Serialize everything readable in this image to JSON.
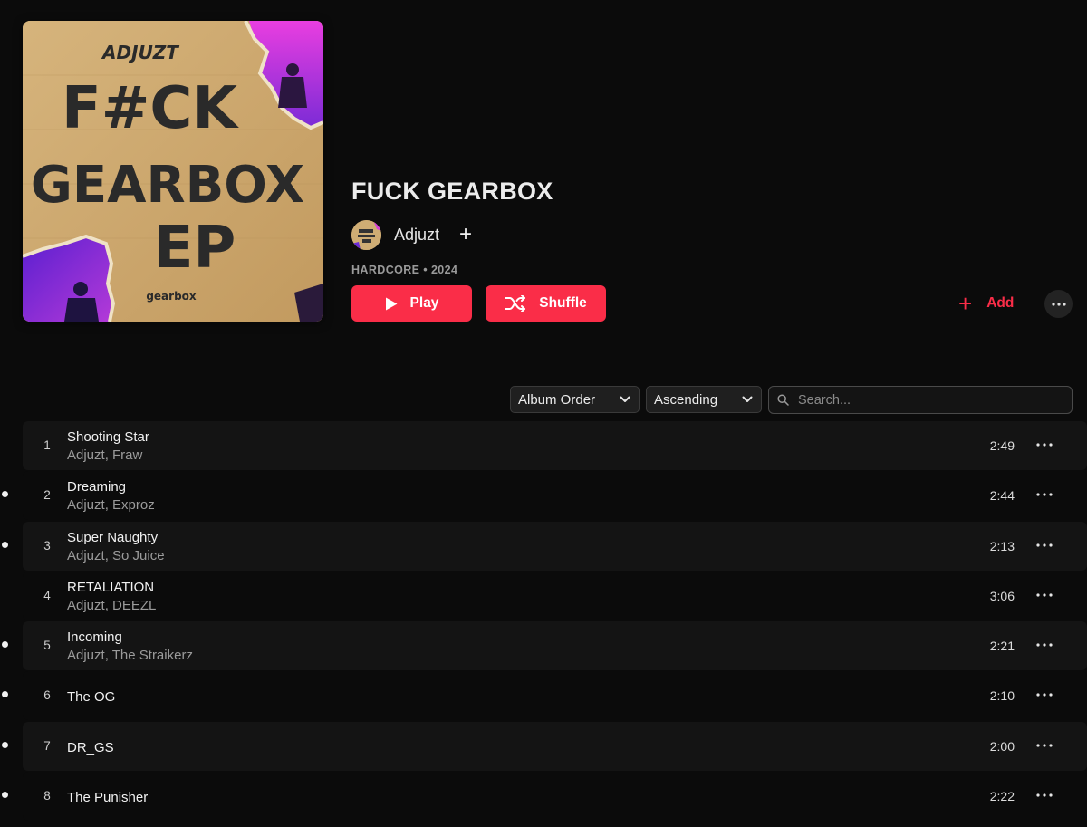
{
  "album": {
    "title": "FUCK GEARBOX",
    "artist": "Adjuzt",
    "meta": "HARDCORE • 2024",
    "cover_text": {
      "logo": "ADJUZT",
      "line1": "F#CK",
      "line2": "GEARBOX",
      "line3": "EP",
      "label": "gearbox"
    }
  },
  "actions": {
    "play_label": "Play",
    "shuffle_label": "Shuffle",
    "add_label": "Add"
  },
  "controls": {
    "sort_order": "Album Order",
    "sort_direction": "Ascending",
    "search_placeholder": "Search..."
  },
  "colors": {
    "accent": "#fa2d48",
    "background": "#0b0b0b",
    "row": "#141414"
  },
  "tracks": [
    {
      "number": "1",
      "title": "Shooting Star",
      "artists": "Adjuzt, Fraw",
      "duration": "2:49"
    },
    {
      "number": "2",
      "title": "Dreaming",
      "artists": "Adjuzt, Exproz",
      "duration": "2:44"
    },
    {
      "number": "3",
      "title": "Super Naughty",
      "artists": "Adjuzt, So Juice",
      "duration": "2:13"
    },
    {
      "number": "4",
      "title": "RETALIATION",
      "artists": "Adjuzt, DEEZL",
      "duration": "3:06"
    },
    {
      "number": "5",
      "title": "Incoming",
      "artists": "Adjuzt, The Straikerz",
      "duration": "2:21"
    },
    {
      "number": "6",
      "title": "The OG",
      "artists": "",
      "duration": "2:10"
    },
    {
      "number": "7",
      "title": "DR_GS",
      "artists": "",
      "duration": "2:00"
    },
    {
      "number": "8",
      "title": "The Punisher",
      "artists": "",
      "duration": "2:22"
    }
  ]
}
